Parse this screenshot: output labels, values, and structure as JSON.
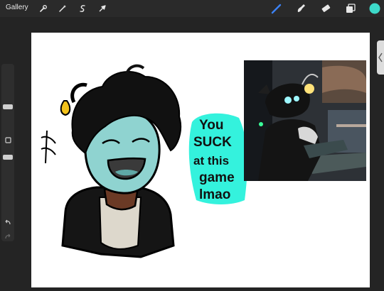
{
  "toolbar": {
    "gallery_label": "Gallery",
    "left_tools": [
      "wrench-icon",
      "magic-wand-icon",
      "selection-icon",
      "transform-arrow-icon"
    ],
    "right_tools": [
      "brush-icon",
      "smudge-icon",
      "eraser-icon",
      "layers-icon",
      "color-swatch"
    ],
    "active_color": "#3dd9c9",
    "brush_active_color": "#3c82f6"
  },
  "sidebar": {
    "buttons": [
      "modify-square-icon",
      "undo-icon",
      "redo-icon"
    ]
  },
  "drawing": {
    "speech_lines": [
      "You",
      "SUCK",
      "at this",
      "game",
      "lmao"
    ],
    "speech_bubble_color": "#34f2dd",
    "skin_color": "#8fd3d0",
    "hair_color": "#111111",
    "lure_color": "#f3c21b"
  }
}
